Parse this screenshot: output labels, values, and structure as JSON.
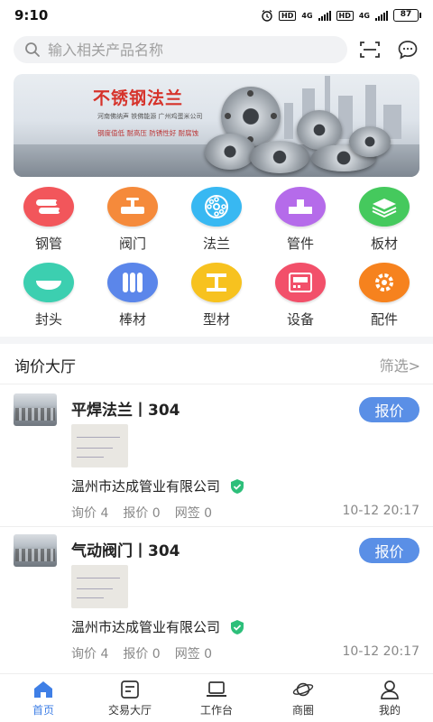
{
  "status_bar": {
    "time": "9:10",
    "hd1": "HD",
    "net1": "4G",
    "hd2": "HD",
    "net2": "4G",
    "battery": "87"
  },
  "search": {
    "placeholder": "输入相关产品名称"
  },
  "banner": {
    "title": "不锈钢法兰",
    "subtitle": "河南佛纳声 铁佛能源 广州鸡蛋米公司",
    "tagline": "钢度值低 耐高压 防锈性好 耐腐蚀"
  },
  "categories": [
    {
      "label": "钢管",
      "color": "#f2565b"
    },
    {
      "label": "阀门",
      "color": "#f58a3b"
    },
    {
      "label": "法兰",
      "color": "#38b8f2"
    },
    {
      "label": "管件",
      "color": "#b56bea"
    },
    {
      "label": "板材",
      "color": "#45c95d"
    },
    {
      "label": "封头",
      "color": "#3ccfb0"
    },
    {
      "label": "棒材",
      "color": "#5b86ea"
    },
    {
      "label": "型材",
      "color": "#f7c21f"
    },
    {
      "label": "设备",
      "color": "#f2506a"
    },
    {
      "label": "配件",
      "color": "#f6821e"
    }
  ],
  "section": {
    "title": "询价大厅",
    "filter": "筛选>"
  },
  "inquiries": [
    {
      "title": "平焊法兰丨304",
      "quote_label": "报价",
      "company": "温州市达成管业有限公司",
      "inquiry": "询价 4",
      "quote": "报价 0",
      "sign": "网签 0",
      "time": "10-12 20:17"
    },
    {
      "title": "气动阀门丨304",
      "quote_label": "报价",
      "company": "温州市达成管业有限公司",
      "inquiry": "询价 4",
      "quote": "报价 0",
      "sign": "网签 0",
      "time": "10-12 20:17"
    }
  ],
  "tabs": [
    {
      "label": "首页",
      "icon": "home-icon"
    },
    {
      "label": "交易大厅",
      "icon": "trade-icon"
    },
    {
      "label": "工作台",
      "icon": "laptop-icon"
    },
    {
      "label": "商圈",
      "icon": "planet-icon"
    },
    {
      "label": "我的",
      "icon": "user-icon"
    }
  ],
  "colors": {
    "accent": "#3f7fe6",
    "quote_button": "#5a8fe6",
    "verified": "#2dbf7a"
  }
}
